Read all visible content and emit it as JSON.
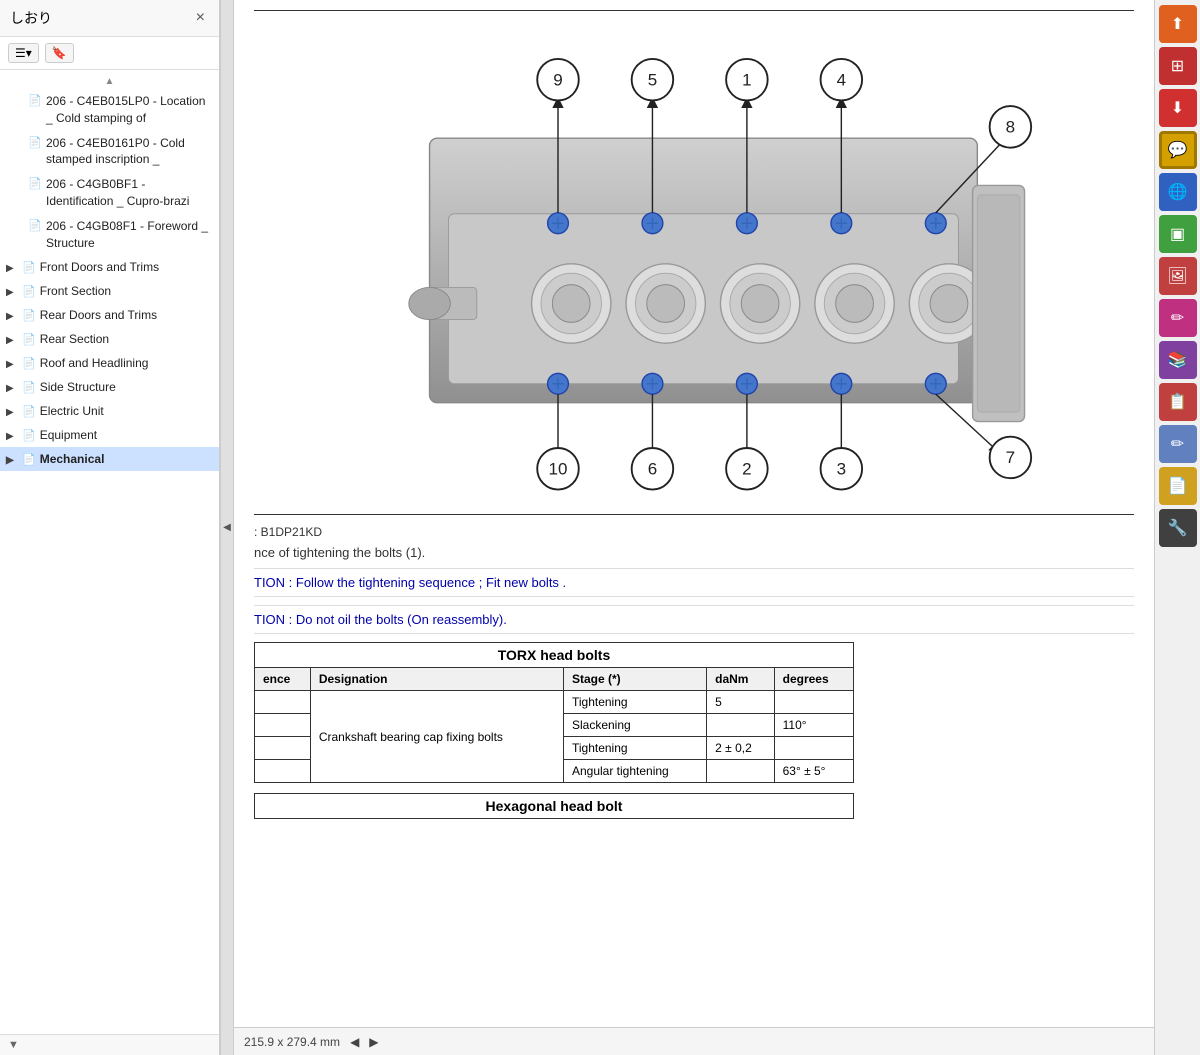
{
  "sidebar": {
    "title": "しおり",
    "close_label": "×",
    "toolbar": {
      "menu_btn": "☰▾",
      "bookmark_btn": "🔖"
    },
    "tree_items": [
      {
        "id": "item1",
        "icon": "📄",
        "label": "206 - C4EB015LP0 - Location _ Cold stamping of",
        "indent": 1,
        "has_expand": false
      },
      {
        "id": "item2",
        "icon": "📄",
        "label": "206 - C4EB0161P0 - Cold stamped inscription _",
        "indent": 1,
        "has_expand": false
      },
      {
        "id": "item3",
        "icon": "📄",
        "label": "206 - C4GB0BF1 - Identification _ Cupro-brazi",
        "indent": 1,
        "has_expand": false
      },
      {
        "id": "item4",
        "icon": "📄",
        "label": "206 - C4GB08F1 - Foreword _ Structure",
        "indent": 1,
        "has_expand": false
      }
    ],
    "sections": [
      {
        "id": "s1",
        "label": "Front Doors and Trims",
        "icon": "📄",
        "expanded": false
      },
      {
        "id": "s2",
        "label": "Front Section",
        "icon": "📄",
        "expanded": false
      },
      {
        "id": "s3",
        "label": "Rear Doors and Trims",
        "icon": "📄",
        "expanded": false
      },
      {
        "id": "s4",
        "label": "Rear Section",
        "icon": "📄",
        "expanded": false
      },
      {
        "id": "s5",
        "label": "Roof and Headlining",
        "icon": "📄",
        "expanded": false
      },
      {
        "id": "s6",
        "label": "Side Structure",
        "icon": "📄",
        "expanded": false
      },
      {
        "id": "s7",
        "label": "Electric Unit",
        "icon": "📄",
        "expanded": false
      },
      {
        "id": "s8",
        "label": "Equipment",
        "icon": "📄",
        "expanded": false
      },
      {
        "id": "s9",
        "label": "Mechanical",
        "icon": "📄",
        "expanded": false,
        "active": true
      }
    ],
    "footer_text": ""
  },
  "content": {
    "code_ref": ": B1DP21KD",
    "intro_text": "nce of tightening the bolts (1).",
    "note1": "TION : Follow the tightening sequence ; Fit new bolts .",
    "note2": "TION : Do not oil the bolts (On reassembly).",
    "table": {
      "header": "TORX head bolts",
      "columns": [
        "ence",
        "Designation",
        "Stage (*)",
        "daNm",
        "degrees"
      ],
      "rows": [
        [
          "",
          "Crankshaft bearing cap fixing bolts",
          "Tightening",
          "5",
          ""
        ],
        [
          "",
          "",
          "Slackening",
          "",
          "110°"
        ],
        [
          "",
          "",
          "Tightening",
          "2 ± 0,2",
          ""
        ],
        [
          "",
          "",
          "Angular tightening",
          "",
          "63° ± 5°"
        ]
      ]
    },
    "table2_header": "Hexagonal head bolt",
    "status_bar": {
      "size": "215.9 x 279.4 mm",
      "nav_left": "◀",
      "nav_right": "▶"
    }
  },
  "right_toolbar": {
    "buttons": [
      {
        "id": "rtb1",
        "icon": "↑+",
        "color": "#e06020",
        "label": "upload-icon"
      },
      {
        "id": "rtb2",
        "icon": "⊞",
        "color": "#c03030",
        "label": "grid-icon"
      },
      {
        "id": "rtb3",
        "icon": "⇓+",
        "color": "#d03030",
        "label": "download-add-icon"
      },
      {
        "id": "rtb4",
        "icon": "💬",
        "color": "#d4a000",
        "label": "comment-icon",
        "active": true
      },
      {
        "id": "rtb5",
        "icon": "🌐",
        "color": "#3060c0",
        "label": "translate-icon"
      },
      {
        "id": "rtb6",
        "icon": "▣",
        "color": "#40a040",
        "label": "compare-icon"
      },
      {
        "id": "rtb7",
        "icon": "🖼",
        "color": "#c04040",
        "label": "image-icon"
      },
      {
        "id": "rtb8",
        "icon": "✏",
        "color": "#c03080",
        "label": "edit-icon"
      },
      {
        "id": "rtb9",
        "icon": "📚",
        "color": "#8040a0",
        "label": "library-icon"
      },
      {
        "id": "rtb10",
        "icon": "📋",
        "color": "#c04040",
        "label": "clipboard-icon"
      },
      {
        "id": "rtb11",
        "icon": "✏",
        "color": "#6080c0",
        "label": "annotate-icon"
      },
      {
        "id": "rtb12",
        "icon": "📄+",
        "color": "#d0a020",
        "label": "page-add-icon"
      },
      {
        "id": "rtb13",
        "icon": "🔧+",
        "color": "#404040",
        "label": "tools-icon"
      }
    ]
  }
}
